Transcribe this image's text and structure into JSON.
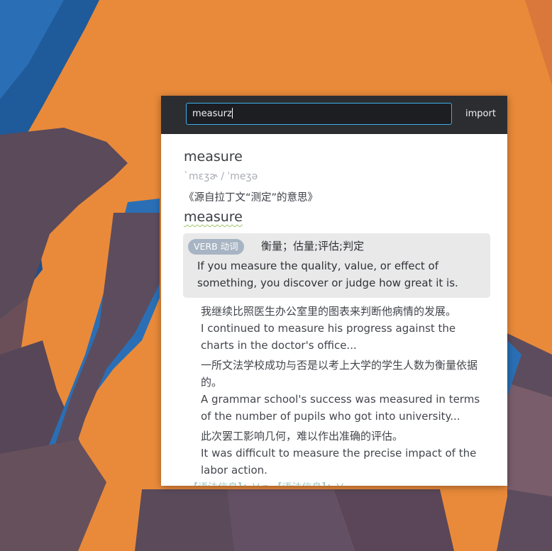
{
  "search": {
    "value": "measurz"
  },
  "toolbar": {
    "import_label": "import"
  },
  "entry": {
    "headword": "measure",
    "phonetic": "ˋmɛʒɚ / ˈmeʒə",
    "etymology": "《源自拉丁文“测定”的意思》",
    "headword2": "measure",
    "sense": {
      "pos": "VERB 动词",
      "cn": "衡量；估量;评估;判定",
      "en": "If you measure the quality, value, or effect of something, you discover or judge how great it is."
    },
    "examples": [
      {
        "cn": "我继续比照医生办公室里的图表来判断他病情的发展。",
        "en": "I continued to measure his progress against the charts in the doctor's office..."
      },
      {
        "cn": "一所文法学校成功与否是以考上大学的学生人数为衡量依据的。",
        "en": "A grammar school's success was measured in terms of the number of pupils who got into university..."
      },
      {
        "cn": "此次罢工影响几何，难以作出准确的评估。",
        "en": "It was difficult to measure the precise impact of the labor action."
      }
    ],
    "grammar_cut": "【语法信息】：V n     【语法信息】：V"
  },
  "colors": {
    "accent": "#3daee9",
    "topbar": "#2b2d31",
    "wallpaper": "#e98a3a"
  }
}
